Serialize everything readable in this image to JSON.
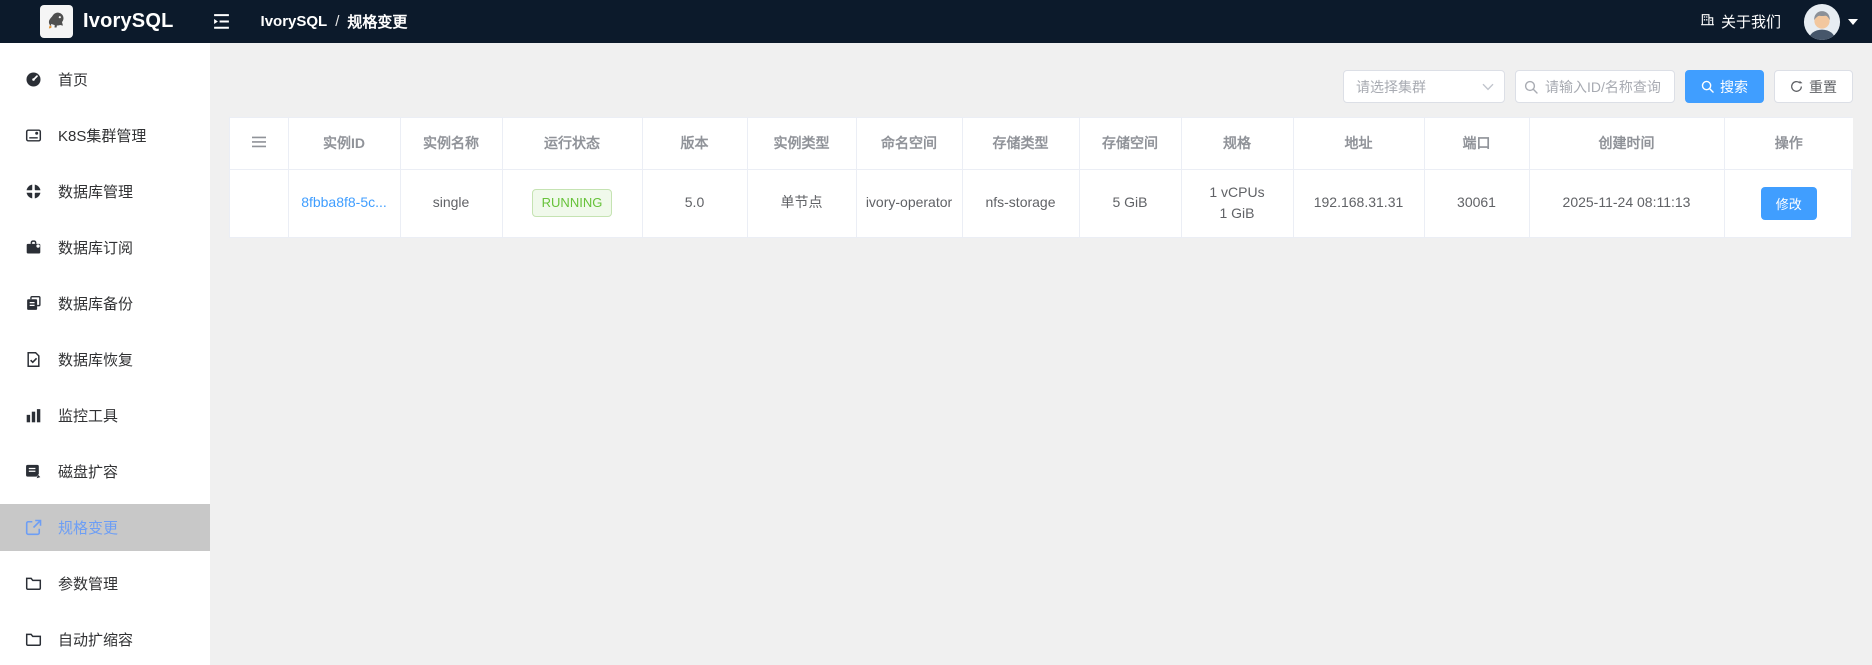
{
  "navbar": {
    "logo_text": "IvorySQL",
    "breadcrumb": {
      "root": "IvorySQL",
      "separator": "/",
      "current": "规格变更"
    },
    "about_label": "关于我们"
  },
  "sidebar": {
    "items": [
      {
        "id": "home",
        "label": "首页",
        "icon": "dashboard-icon",
        "active": false
      },
      {
        "id": "k8s-cluster",
        "label": "K8S集群管理",
        "icon": "cluster-card-icon",
        "active": false
      },
      {
        "id": "database-manage",
        "label": "数据库管理",
        "icon": "segmented-circle-icon",
        "active": false
      },
      {
        "id": "database-subscribe",
        "label": "数据库订阅",
        "icon": "briefcase-icon",
        "active": false
      },
      {
        "id": "database-backup",
        "label": "数据库备份",
        "icon": "copy-document-icon",
        "active": false
      },
      {
        "id": "database-restore",
        "label": "数据库恢复",
        "icon": "document-check-icon",
        "active": false
      },
      {
        "id": "monitor-tools",
        "label": "监控工具",
        "icon": "bar-chart-icon",
        "active": false
      },
      {
        "id": "disk-expand",
        "label": "磁盘扩容",
        "icon": "disk-edit-icon",
        "active": false
      },
      {
        "id": "spec-change",
        "label": "规格变更",
        "icon": "external-link-icon",
        "active": true
      },
      {
        "id": "param-manage",
        "label": "参数管理",
        "icon": "folder-icon",
        "active": false
      },
      {
        "id": "auto-scale",
        "label": "自动扩缩容",
        "icon": "folder-icon",
        "active": false
      }
    ]
  },
  "filters": {
    "cluster_select_placeholder": "请选择集群",
    "search_placeholder": "请输入ID/名称查询",
    "search_button": "搜索",
    "reset_button": "重置"
  },
  "table": {
    "columns": [
      "",
      "实例ID",
      "实例名称",
      "运行状态",
      "版本",
      "实例类型",
      "命名空间",
      "存储类型",
      "存储空间",
      "规格",
      "地址",
      "端口",
      "创建时间",
      "操作"
    ],
    "rows": [
      {
        "instance_id": "8fbba8f8-5c...",
        "instance_name": "single",
        "status": "RUNNING",
        "version": "5.0",
        "instance_type": "单节点",
        "namespace": "ivory-operator",
        "storage_type": "nfs-storage",
        "storage_size": "5 GiB",
        "spec_lines": [
          "1 vCPUs",
          "1 GiB"
        ],
        "address": "192.168.31.31",
        "port": "30061",
        "created_at": "2025-11-24 08:11:13",
        "action": "修改"
      }
    ]
  },
  "colors": {
    "accent": "#409eff",
    "status_running": "#67c23a",
    "sidebar_active_text": "#6d9ef5",
    "navbar_bg": "#0c1a2b"
  }
}
